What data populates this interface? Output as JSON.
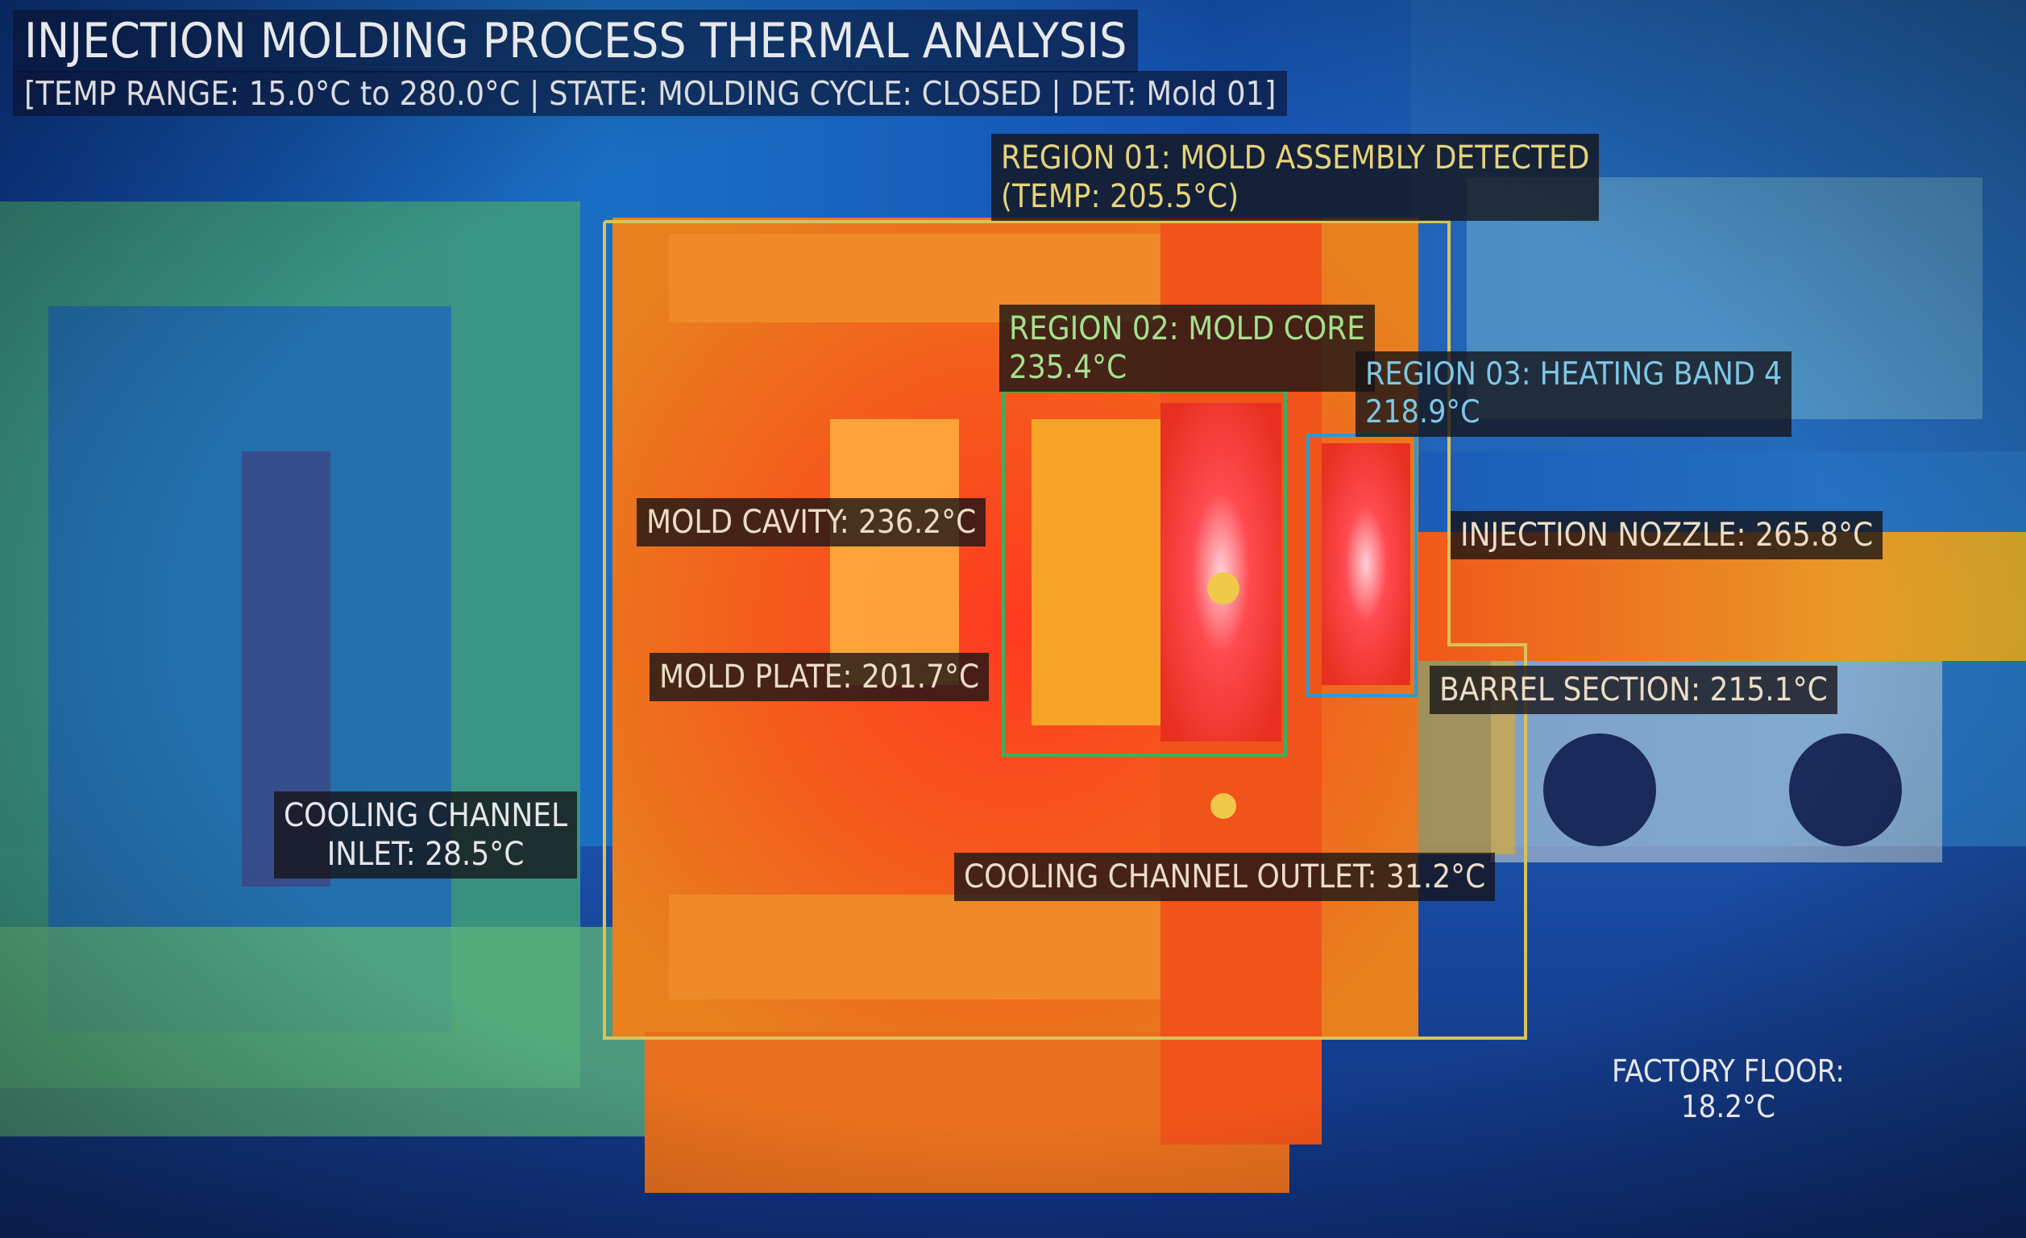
{
  "header": {
    "title": "INJECTION MOLDING PROCESS THERMAL ANALYSIS",
    "subtitle": "[TEMP RANGE: 15.0°C to 280.0°C | STATE: MOLDING CYCLE: CLOSED | DET: Mold 01]"
  },
  "regions": {
    "r1": {
      "line1": "REGION 01: MOLD ASSEMBLY DETECTED",
      "line2": "(TEMP: 205.5°C)",
      "color": "#d9c25a"
    },
    "r2": {
      "line1": "REGION 02: MOLD CORE",
      "line2": "235.4°C",
      "color": "#3fae5c"
    },
    "r3": {
      "line1": "REGION 03: HEATING BAND 4",
      "line2": "218.9°C",
      "color": "#2a9bd0"
    }
  },
  "readings": {
    "mold_cavity": "MOLD CAVITY: 236.2°C",
    "mold_plate": "MOLD PLATE: 201.7°C",
    "injection_nozzle": "INJECTION NOZZLE: 265.8°C",
    "barrel_section": "BARREL SECTION: 215.1°C",
    "cooling_outlet": "COOLING CHANNEL OUTLET: 31.2°C",
    "cooling_inlet_1": "COOLING CHANNEL",
    "cooling_inlet_2": "INLET: 28.5°C",
    "factory_floor_1": "FACTORY FLOOR:",
    "factory_floor_2": "18.2°C"
  }
}
